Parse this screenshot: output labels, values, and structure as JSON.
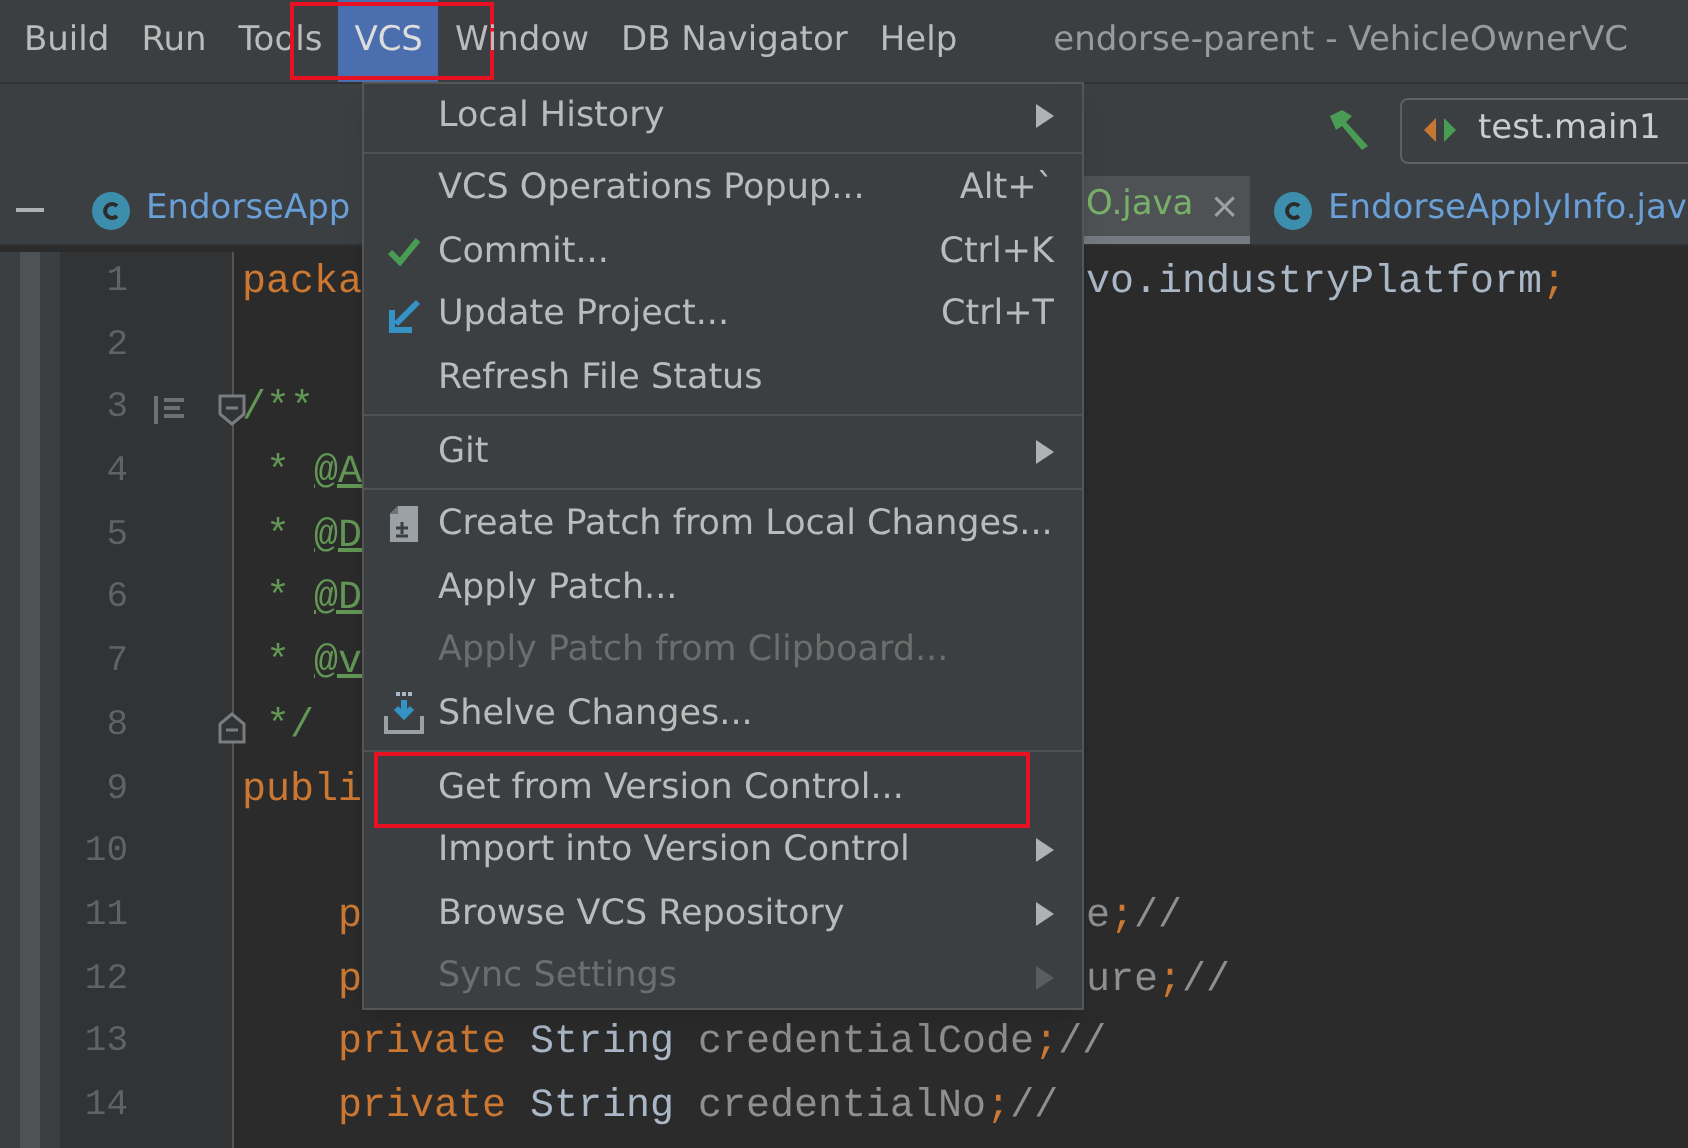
{
  "menubar": {
    "items": [
      {
        "label": "Build",
        "selected": false,
        "annotated": false
      },
      {
        "label": "Run",
        "selected": false,
        "annotated": false
      },
      {
        "label": "Tools",
        "selected": false,
        "annotated": false
      },
      {
        "label": "VCS",
        "selected": true,
        "annotated": true
      },
      {
        "label": "Window",
        "selected": false,
        "annotated": false
      },
      {
        "label": "DB Navigator",
        "selected": false,
        "annotated": false
      },
      {
        "label": "Help",
        "selected": false,
        "annotated": false
      }
    ],
    "title": "endorse-parent - VehicleOwnerVC"
  },
  "toolbar": {
    "run_config": "test.main1"
  },
  "tabs": [
    {
      "label": "EndorseApp",
      "selected": false,
      "modified": false
    },
    {
      "label": "O.java",
      "selected": true,
      "modified": true,
      "close": "×"
    },
    {
      "label": "EndorseApplyInfo.jav",
      "selected": false,
      "modified": false
    }
  ],
  "editor": {
    "lines": [
      {
        "number": "1",
        "kind": "code",
        "left": [
          {
            "kind": "keyword",
            "text": "packa"
          }
        ],
        "right": [
          {
            "kind": "plain",
            "text": "vo.industryPlatform"
          },
          {
            "kind": "keyword",
            "text": ";"
          }
        ]
      },
      {
        "number": "2",
        "kind": "code"
      },
      {
        "number": "3",
        "kind": "doc-start",
        "left": [
          {
            "kind": "comment",
            "text": "/**"
          }
        ]
      },
      {
        "number": "4",
        "kind": "code",
        "left": [
          {
            "kind": "comment",
            "text": " * "
          },
          {
            "kind": "doctag",
            "text": "@A"
          }
        ]
      },
      {
        "number": "5",
        "kind": "code",
        "left": [
          {
            "kind": "comment",
            "text": " * "
          },
          {
            "kind": "doctag",
            "text": "@D"
          }
        ]
      },
      {
        "number": "6",
        "kind": "code",
        "left": [
          {
            "kind": "comment",
            "text": " * "
          },
          {
            "kind": "doctag",
            "text": "@D"
          }
        ]
      },
      {
        "number": "7",
        "kind": "code",
        "left": [
          {
            "kind": "comment",
            "text": " * "
          },
          {
            "kind": "doctag",
            "text": "@v"
          }
        ]
      },
      {
        "number": "8",
        "kind": "doc-end",
        "left": [
          {
            "kind": "comment",
            "text": " */"
          }
        ]
      },
      {
        "number": "9",
        "kind": "code",
        "left": [
          {
            "kind": "keyword",
            "text": "publi"
          }
        ]
      },
      {
        "number": "10",
        "kind": "code"
      },
      {
        "number": "11",
        "kind": "code",
        "indented": true,
        "left": [
          {
            "kind": "keyword",
            "text": "p"
          }
        ],
        "right": [
          {
            "kind": "field",
            "text": "e"
          },
          {
            "kind": "keyword",
            "text": ";"
          },
          {
            "kind": "field",
            "text": "//"
          }
        ]
      },
      {
        "number": "12",
        "kind": "code",
        "indented": true,
        "left": [
          {
            "kind": "keyword",
            "text": "p"
          }
        ],
        "right": [
          {
            "kind": "field",
            "text": "ure"
          },
          {
            "kind": "keyword",
            "text": ";"
          },
          {
            "kind": "field",
            "text": "//"
          }
        ]
      },
      {
        "number": "13",
        "kind": "code",
        "indented": true,
        "left": [
          {
            "kind": "keyword",
            "text": "private "
          },
          {
            "kind": "plain",
            "text": "String "
          },
          {
            "kind": "field",
            "text": "credentialCode"
          },
          {
            "kind": "keyword",
            "text": ";"
          },
          {
            "kind": "field",
            "text": "//"
          }
        ]
      },
      {
        "number": "14",
        "kind": "code",
        "indented": true,
        "left": [
          {
            "kind": "keyword",
            "text": "private "
          },
          {
            "kind": "plain",
            "text": "String "
          },
          {
            "kind": "field",
            "text": "credentialNo"
          },
          {
            "kind": "keyword",
            "text": ";"
          },
          {
            "kind": "field",
            "text": "//"
          }
        ]
      }
    ]
  },
  "menu": {
    "items": [
      {
        "kind": "plain",
        "label": "Local History",
        "submenu": true,
        "disabled": false,
        "annotated": false
      },
      {
        "kind": "separator"
      },
      {
        "kind": "plain",
        "label": "VCS Operations Popup...",
        "shortcut": "Alt+`",
        "submenu": false,
        "disabled": false,
        "annotated": false
      },
      {
        "kind": "commit",
        "label": "Commit...",
        "shortcut": "Ctrl+K",
        "submenu": false,
        "disabled": false,
        "annotated": false
      },
      {
        "kind": "update",
        "label": "Update Project...",
        "shortcut": "Ctrl+T",
        "submenu": false,
        "disabled": false,
        "annotated": false
      },
      {
        "kind": "plain",
        "label": "Refresh File Status",
        "submenu": false,
        "disabled": false,
        "annotated": false
      },
      {
        "kind": "separator"
      },
      {
        "kind": "plain",
        "label": "Git",
        "submenu": true,
        "disabled": false,
        "annotated": false
      },
      {
        "kind": "separator"
      },
      {
        "kind": "patch",
        "label": "Create Patch from Local Changes...",
        "submenu": false,
        "disabled": false,
        "annotated": false
      },
      {
        "kind": "plain",
        "label": "Apply Patch...",
        "submenu": false,
        "disabled": false,
        "annotated": false
      },
      {
        "kind": "plain",
        "label": "Apply Patch from Clipboard...",
        "submenu": false,
        "disabled": true,
        "annotated": false
      },
      {
        "kind": "shelve",
        "label": "Shelve Changes...",
        "submenu": false,
        "disabled": false,
        "annotated": false
      },
      {
        "kind": "separator"
      },
      {
        "kind": "plain",
        "label": "Get from Version Control...",
        "submenu": false,
        "disabled": false,
        "annotated": true
      },
      {
        "kind": "plain",
        "label": "Import into Version Control",
        "submenu": true,
        "disabled": false,
        "annotated": false
      },
      {
        "kind": "plain",
        "label": "Browse VCS Repository",
        "submenu": true,
        "disabled": false,
        "annotated": false
      },
      {
        "kind": "plain",
        "label": "Sync Settings",
        "submenu": true,
        "disabled": true,
        "annotated": false
      }
    ]
  }
}
